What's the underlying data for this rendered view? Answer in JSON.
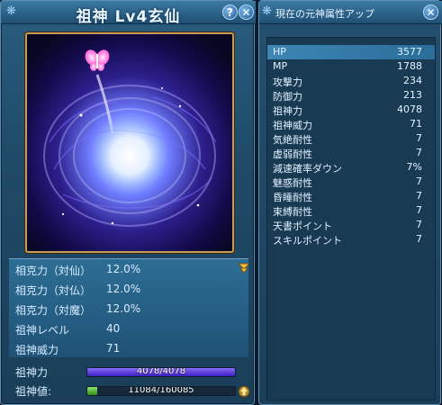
{
  "left_panel": {
    "title": "祖神 Lv4玄仙",
    "help_label": "?",
    "close_label": "✕",
    "stats": [
      {
        "label": "相克力（対仙）",
        "value": "12.0%"
      },
      {
        "label": "相克力（対仏）",
        "value": "12.0%"
      },
      {
        "label": "相克力（対魔）",
        "value": "12.0%"
      },
      {
        "label": "祖神レベル",
        "value": "40"
      },
      {
        "label": "祖神威力",
        "value": "71"
      }
    ],
    "power_bar": {
      "label": "祖神力",
      "text": "4078/4078",
      "fill": 1.0
    },
    "exp_bar": {
      "label": "祖神値:",
      "text": "11084/160085",
      "fill": 0.0692
    }
  },
  "right_panel": {
    "title": "現在の元神属性アップ",
    "close_label": "✕",
    "rows": [
      {
        "label": "HP",
        "value": "3577"
      },
      {
        "label": "MP",
        "value": "1788"
      },
      {
        "label": "攻撃力",
        "value": "234"
      },
      {
        "label": "防御力",
        "value": "213"
      },
      {
        "label": "祖神力",
        "value": "4078"
      },
      {
        "label": "祖神威力",
        "value": "71"
      },
      {
        "label": "気絶耐性",
        "value": "7"
      },
      {
        "label": "虚弱耐性",
        "value": "7"
      },
      {
        "label": "減速確率ダウン",
        "value": "7%"
      },
      {
        "label": "魅惑耐性",
        "value": "7"
      },
      {
        "label": "昏睡耐性",
        "value": "7"
      },
      {
        "label": "束縛耐性",
        "value": "7"
      },
      {
        "label": "天書ポイント",
        "value": "7"
      },
      {
        "label": "スキルポイント",
        "value": "7"
      }
    ]
  },
  "colors": {
    "panel_bg": "#1f4a68",
    "frame_gold": "#c99a55",
    "power_bar": "#5a3fe0",
    "exp_bar": "#5cbf3a",
    "highlight_row": "#3f86b4"
  },
  "icons": [
    "ornament-icon",
    "help-icon",
    "close-icon",
    "dropdown-arrow-icon",
    "level-up-icon",
    "butterfly-icon"
  ]
}
